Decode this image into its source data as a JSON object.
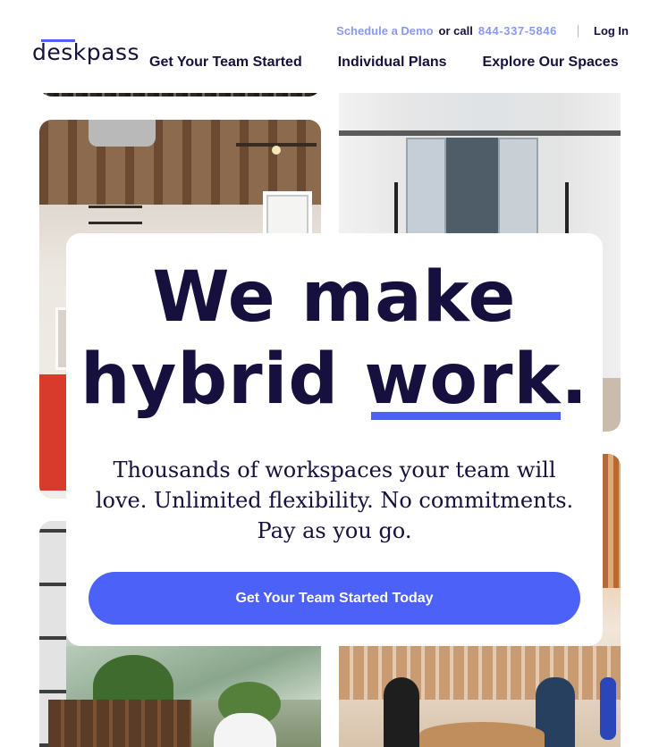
{
  "brand": {
    "logo_text": "deskpass",
    "accent": "#4b61f8",
    "ink": "#15103e",
    "link_color": "#8a99f0"
  },
  "topbar": {
    "demo_label": "Schedule a Demo",
    "or_call": "or call",
    "phone": "844-337-5846",
    "login_label": "Log In"
  },
  "nav": {
    "items": [
      {
        "label": "Get Your Team Started"
      },
      {
        "label": "Individual Plans"
      },
      {
        "label": "Explore Our Spaces"
      }
    ]
  },
  "hero": {
    "headline_line1": "We make",
    "headline_word1": "hybrid",
    "headline_word2": "work",
    "headline_period": ".",
    "subtext": "Thousands of workspaces your team will love. Unlimited flexibility. No commitments. Pay as you go.",
    "cta_label": "Get Your Team Started Today"
  }
}
